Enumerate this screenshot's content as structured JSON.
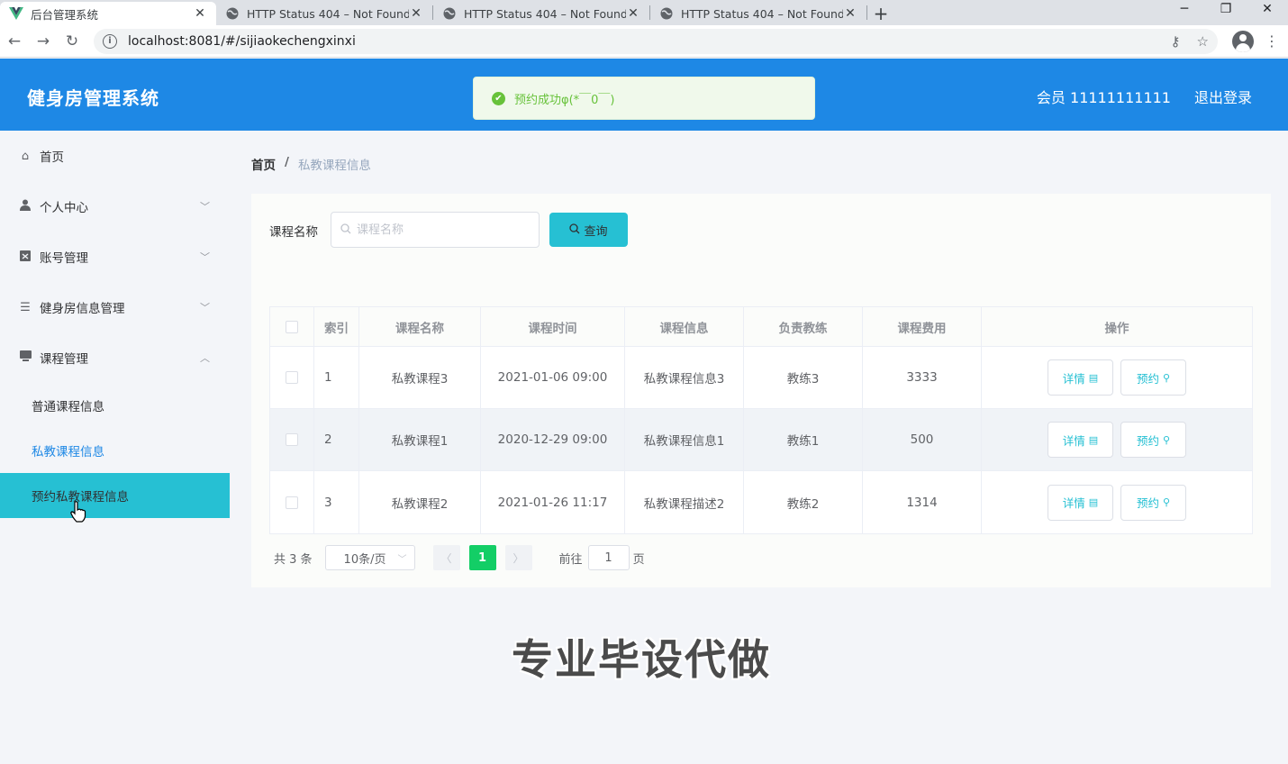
{
  "browser": {
    "tabs": [
      {
        "title": "后台管理系统",
        "icon": "vue-logo-icon",
        "active": true
      },
      {
        "title": "HTTP Status 404 – Not Found",
        "icon": "globe-icon",
        "active": false
      },
      {
        "title": "HTTP Status 404 – Not Found",
        "icon": "globe-icon",
        "active": false
      },
      {
        "title": "HTTP Status 404 – Not Found",
        "icon": "globe-icon",
        "active": false
      }
    ],
    "close_glyph": "✕",
    "new_tab_glyph": "+",
    "url": "localhost:8081/#/sijiaokechengxinxi"
  },
  "header": {
    "title": "健身房管理系统",
    "user": "会员 11111111111",
    "logout": "退出登录",
    "bg_color": "#1e88e5"
  },
  "toast": {
    "message": "预约成功φ(*￣0￣)",
    "color": "#67c23a"
  },
  "sidebar": {
    "items": [
      {
        "label": "首页",
        "icon": "home-icon"
      },
      {
        "label": "个人中心",
        "icon": "user-icon"
      },
      {
        "label": "账号管理",
        "icon": "account-icon"
      },
      {
        "label": "健身房信息管理",
        "icon": "list-icon"
      },
      {
        "label": "课程管理",
        "icon": "course-icon"
      }
    ],
    "subitems": [
      {
        "label": "普通课程信息"
      },
      {
        "label": "私教课程信息",
        "current": true
      },
      {
        "label": "预约私教课程信息",
        "hover": true
      }
    ],
    "accent": "#26c0d3"
  },
  "breadcrumb": {
    "home": "首页",
    "separator": "/",
    "current": "私教课程信息"
  },
  "search": {
    "label": "课程名称",
    "placeholder": "课程名称",
    "button": "查询"
  },
  "table": {
    "columns": [
      "索引",
      "课程名称",
      "课程时间",
      "课程信息",
      "负责教练",
      "课程费用",
      "操作"
    ],
    "rows": [
      {
        "index": "1",
        "name": "私教课程3",
        "time": "2021-01-06 09:00",
        "info": "私教课程信息3",
        "coach": "教练3",
        "fee": "3333"
      },
      {
        "index": "2",
        "name": "私教课程1",
        "time": "2020-12-29 09:00",
        "info": "私教课程信息1",
        "coach": "教练1",
        "fee": "500"
      },
      {
        "index": "3",
        "name": "私教课程2",
        "time": "2021-01-26 11:17",
        "info": "私教课程描述2",
        "coach": "教练2",
        "fee": "1314"
      }
    ],
    "detail_label": "详情",
    "reserve_label": "预约"
  },
  "pagination": {
    "total": "共 3 条",
    "page_size": "10条/页",
    "current_page": "1",
    "goto_label": "前往",
    "goto_value": "1",
    "page_suffix": "页"
  },
  "watermark": "专业毕设代做"
}
